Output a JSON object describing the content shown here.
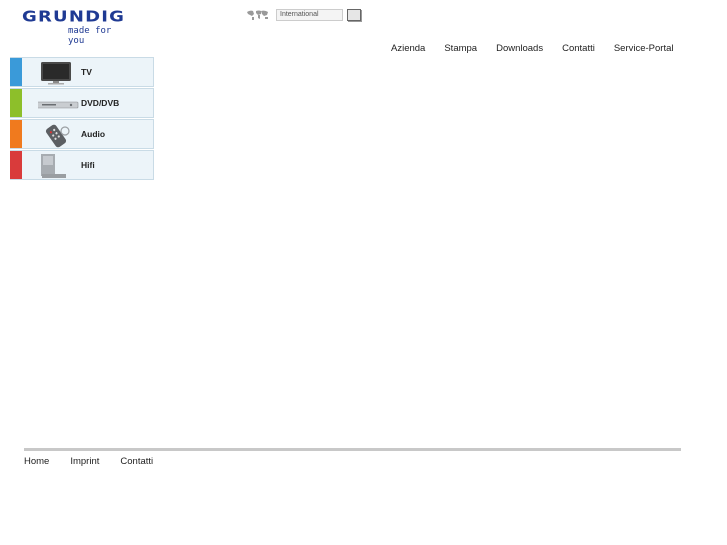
{
  "brand": {
    "name": "GRUNDIG",
    "tagline": "made for you",
    "color": "#1f3a93"
  },
  "region": {
    "value": "International",
    "globe_icon": "world-map-icon",
    "go_icon": "go-button"
  },
  "top_nav": [
    {
      "label": "Azienda"
    },
    {
      "label": "Stampa"
    },
    {
      "label": "Downloads"
    },
    {
      "label": "Contatti"
    },
    {
      "label": "Service-Portal"
    }
  ],
  "categories": [
    {
      "label": "TV",
      "color": "#3a9ad9",
      "icon": "tv-icon"
    },
    {
      "label": "DVD/DVB",
      "color": "#8dbf2a",
      "icon": "dvd-player-icon"
    },
    {
      "label": "Audio",
      "color": "#f07a1e",
      "icon": "audio-remote-icon"
    },
    {
      "label": "Hifi",
      "color": "#d93b3b",
      "icon": "hifi-system-icon"
    }
  ],
  "footer_nav": [
    {
      "label": "Home"
    },
    {
      "label": "Imprint"
    },
    {
      "label": "Contatti"
    }
  ]
}
